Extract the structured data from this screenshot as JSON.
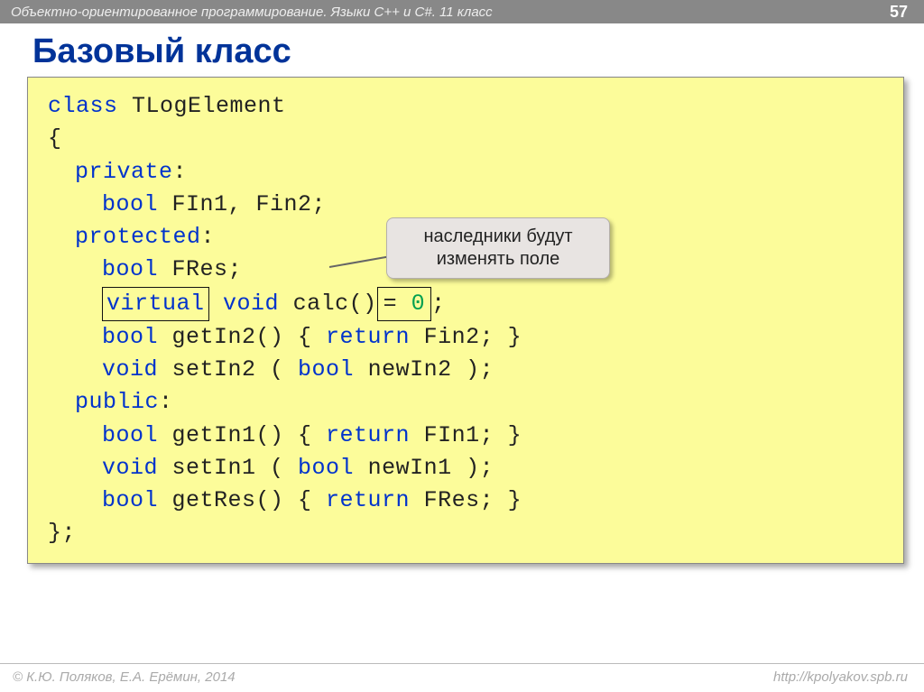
{
  "header": {
    "course": "Объектно-ориентированное программирование. Языки C++ и C#. 11 класс",
    "page": "57"
  },
  "title": "Базовый класс",
  "callout": "наследники будут изменять поле",
  "code": {
    "kw_class": "class",
    "classname": "TLogElement",
    "brace_open": "{",
    "kw_private": "private",
    "colon": ":",
    "kw_bool": "bool",
    "priv_fields": " FIn1, Fin2;",
    "kw_protected": "protected",
    "prot_field": " FRes;",
    "kw_virtual": "virtual",
    "kw_void": "void",
    "calc_sig": " calc()",
    "eq": "= ",
    "zero": "0",
    "semi": ";",
    "getIn2_a": " getIn2() { ",
    "kw_return": "return",
    "getIn2_b": " Fin2; }",
    "setIn2_a": " setIn2 ( ",
    "setIn2_b": " newIn2 );",
    "kw_public": "public",
    "getIn1_a": " getIn1() { ",
    "getIn1_b": " FIn1; }",
    "setIn1_a": " setIn1 ( ",
    "setIn1_b": " newIn1 );",
    "getRes_a": " getRes() { ",
    "getRes_b": " FRes; }",
    "brace_close": "};"
  },
  "footer": {
    "copyright": "© К.Ю. Поляков, Е.А. Ерёмин, 2014",
    "url": "http://kpolyakov.spb.ru"
  }
}
